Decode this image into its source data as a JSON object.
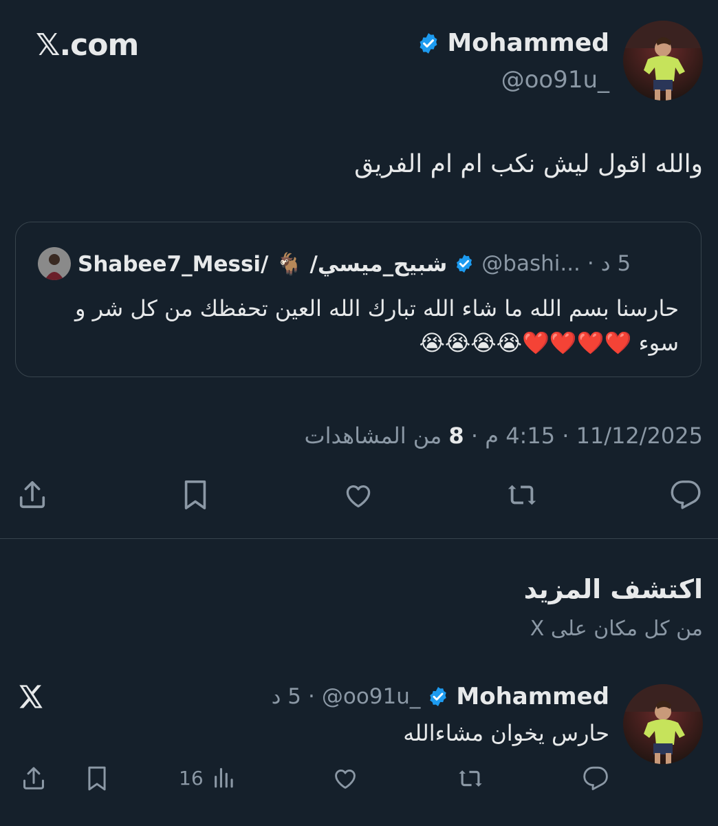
{
  "header": {
    "brand": "𝕏.com"
  },
  "tweet": {
    "author_name": "Mohammed",
    "author_handle": "@oo91u_",
    "text": "والله اقول ليش نكب ام ام الفريق",
    "quote": {
      "author_name": "Shabee7_Messi/ 🐐 /شبيح_ميسي",
      "author_handle": "@bashi...",
      "time": "5 د",
      "text": "حارسنا بسم الله ما شاء الله تبارك الله العين تحفظك من كل شر و سوء ❤️❤️❤️❤️😭😭😭😭"
    },
    "meta": {
      "date": "11/12/2025",
      "time": "4:15 م",
      "views_count": "8",
      "views_label": "من المشاهدات"
    }
  },
  "discover": {
    "title": "اكتشف المزيد",
    "subtitle": "من كل مكان على X"
  },
  "post": {
    "author_name": "Mohammed",
    "author_handle": "@oo91u_",
    "time": "5 د",
    "text": "حارس يخوان مشاءالله",
    "views": "16"
  },
  "colors": {
    "background": "#15202b",
    "text": "#e7e9ea",
    "muted": "#8b98a5",
    "border": "#38444d",
    "verified": "#1d9bf0"
  }
}
